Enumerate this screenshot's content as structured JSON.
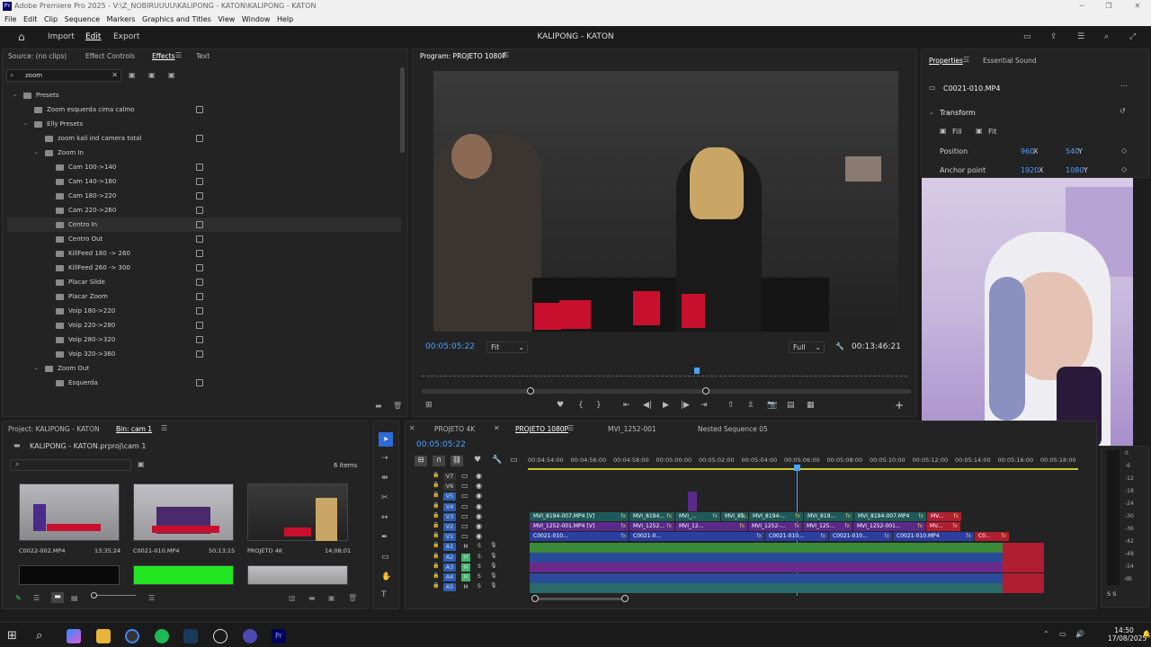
{
  "titlebar": {
    "title": "Adobe Premiere Pro 2025 - V:\\Z_NOBIRUUUU\\KALIPONG - KATON\\KALIPONG - KATON",
    "logo": "Pr"
  },
  "menu": [
    "File",
    "Edit",
    "Clip",
    "Sequence",
    "Markers",
    "Graphics and Titles",
    "View",
    "Window",
    "Help"
  ],
  "header": {
    "tabs": [
      "Import",
      "Edit",
      "Export"
    ],
    "active": "Edit",
    "project_title": "KALIPONG - KATON"
  },
  "left_panel": {
    "tabs": [
      "Source: (no clips)",
      "Effect Controls",
      "Effects",
      "Text"
    ],
    "active": "Effects",
    "search": "zoom",
    "items": [
      {
        "label": "Presets",
        "level": 0,
        "type": "folder"
      },
      {
        "label": "Zoom esquerda cima calmo",
        "level": 1,
        "type": "preset"
      },
      {
        "label": "Elly Presets",
        "level": 1,
        "type": "folder"
      },
      {
        "label": "zoom kali ind camera total",
        "level": 2,
        "type": "preset"
      },
      {
        "label": "Zoom In",
        "level": 2,
        "type": "folder"
      },
      {
        "label": "Cam 100->140",
        "level": 3,
        "type": "preset"
      },
      {
        "label": "Cam 140->180",
        "level": 3,
        "type": "preset"
      },
      {
        "label": "Cam 180->220",
        "level": 3,
        "type": "preset"
      },
      {
        "label": "Cam 220->260",
        "level": 3,
        "type": "preset"
      },
      {
        "label": "Centro In",
        "level": 3,
        "type": "preset",
        "selected": true
      },
      {
        "label": "Centro Out",
        "level": 3,
        "type": "preset"
      },
      {
        "label": "KillFeed 180 -> 260",
        "level": 3,
        "type": "preset"
      },
      {
        "label": "KillFeed 260 -> 300",
        "level": 3,
        "type": "preset"
      },
      {
        "label": "Placar Slide",
        "level": 3,
        "type": "preset"
      },
      {
        "label": "Placar Zoom",
        "level": 3,
        "type": "preset"
      },
      {
        "label": "Voip 180->220",
        "level": 3,
        "type": "preset"
      },
      {
        "label": "Voip 220->280",
        "level": 3,
        "type": "preset"
      },
      {
        "label": "Voip 280->320",
        "level": 3,
        "type": "preset"
      },
      {
        "label": "Voip 320->360",
        "level": 3,
        "type": "preset"
      },
      {
        "label": "Zoom Out",
        "level": 2,
        "type": "folder"
      },
      {
        "label": "Esquerda",
        "level": 3,
        "type": "preset"
      }
    ]
  },
  "program": {
    "label": "Program: PROJETO 1080P",
    "timecode": "00:05:05:22",
    "fit": "Fit",
    "quality": "Full",
    "duration": "00:13:46:21"
  },
  "properties": {
    "tabs": [
      "Properties",
      "Essential Sound"
    ],
    "clip": "C0021-010.MP4",
    "section": "Transform",
    "fill": "Fill",
    "fit": "Fit",
    "position_label": "Position",
    "position_x": "960",
    "position_y": "540",
    "anchor_label": "Anchor point",
    "anchor_x": "1920",
    "anchor_y": "1080",
    "x": "X",
    "y": "Y"
  },
  "project": {
    "tabs": [
      "Project: KALIPONG - KATON",
      "Bin: cam 1"
    ],
    "path": "KALIPONG - KATON.prproj\\cam 1",
    "count": "6 items",
    "items": [
      {
        "name": "C0022-002.MP4",
        "dur": "13;35;24"
      },
      {
        "name": "C0021-010.MP4",
        "dur": "50;13;15"
      },
      {
        "name": "PROJETO 4K",
        "dur": "14;08;01"
      }
    ]
  },
  "timeline": {
    "tabs": [
      "PROJETO 4K",
      "PROJETO 1080P",
      "MVI_1252-001",
      "Nested Sequence 05"
    ],
    "active": "PROJETO 1080P",
    "timecode": "00:05:05:22",
    "ruler": [
      "00:04:54:00",
      "00:04:56:00",
      "00:04:58:00",
      "00:05:00:00",
      "00:05:02:00",
      "00:05:04:00",
      "00:05:06:00",
      "00:05:08:00",
      "00:05:10:00",
      "00:05:12:00",
      "00:05:14:00",
      "00:05:16:00",
      "00:05:18:00"
    ],
    "tracks": [
      "V7",
      "V6",
      "V5",
      "V4",
      "V3",
      "V2",
      "V1",
      "A1",
      "A2",
      "A3",
      "A4",
      "A5"
    ],
    "v3": [
      "MVI_8194-007.MP4 [V]",
      "MVI_8194...",
      "MVI_...",
      "MVI_81...",
      "MVI_8194-...",
      "MVI_819...",
      "MVI_8194-007.MP4",
      "MV..."
    ],
    "v2": [
      "MVI_1252-001.MP4 [V]",
      "MVI_1252...",
      "MVI_12...",
      "MVI_1252-...",
      "MVI_125...",
      "MVI_1252-001...",
      "MV..."
    ],
    "v1": [
      "C0021-010...",
      "C0021-0...",
      "C0021-010...",
      "C0021-010...",
      "C0021-010.MP4",
      "C0..."
    ],
    "fx": "fx",
    "m": "M",
    "s": "S"
  },
  "meter": {
    "labels": [
      "0",
      "-6",
      "-12",
      "-18",
      "-24",
      "-30",
      "-36",
      "-42",
      "-48",
      "-54",
      "dB"
    ],
    "ss": "S  S"
  },
  "clock": {
    "time": "14:50",
    "date": "17/08/2025"
  }
}
